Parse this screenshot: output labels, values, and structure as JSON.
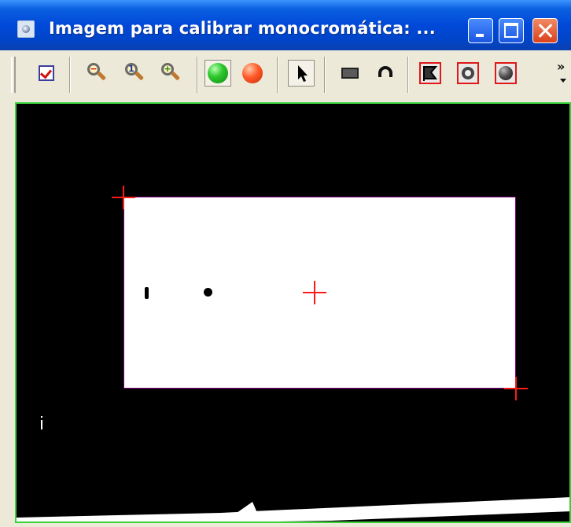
{
  "window": {
    "title": "Imagem para calibrar monocromática: ...",
    "icon": "app-icon"
  },
  "title_buttons": [
    {
      "name": "minimize-button",
      "icon": "minimize-icon"
    },
    {
      "name": "maximize-button",
      "icon": "maximize-icon"
    },
    {
      "name": "close-button",
      "icon": "close-icon"
    }
  ],
  "toolbar": {
    "overflow_label": "»",
    "tools": [
      {
        "name": "check-tool-button",
        "icon": "checklist-icon"
      },
      {
        "name": "zoom-out-button",
        "icon": "zoom-out-icon",
        "sign": "−"
      },
      {
        "name": "zoom-1-button",
        "icon": "zoom-one-icon",
        "sign": "1"
      },
      {
        "name": "zoom-in-button",
        "icon": "zoom-in-icon",
        "sign": "+"
      },
      {
        "name": "start-button",
        "icon": "green-circle-icon",
        "pressed": true
      },
      {
        "name": "stop-button",
        "icon": "red-circle-icon"
      },
      {
        "name": "select-button",
        "icon": "pointer-arrow-icon",
        "pressed": true
      },
      {
        "name": "rectangle-tool-button",
        "icon": "rectangle-icon"
      },
      {
        "name": "arc-tool-button",
        "icon": "arc-icon"
      },
      {
        "name": "flag-tool-button",
        "icon": "flag-icon"
      },
      {
        "name": "ring-tool-button",
        "icon": "ring-icon"
      },
      {
        "name": "ball-tool-button",
        "icon": "ball-icon"
      }
    ]
  },
  "colors": {
    "canvas_border": "#3bd23b",
    "rect_border": "#800080",
    "crosshair": "#ff1a1a"
  }
}
